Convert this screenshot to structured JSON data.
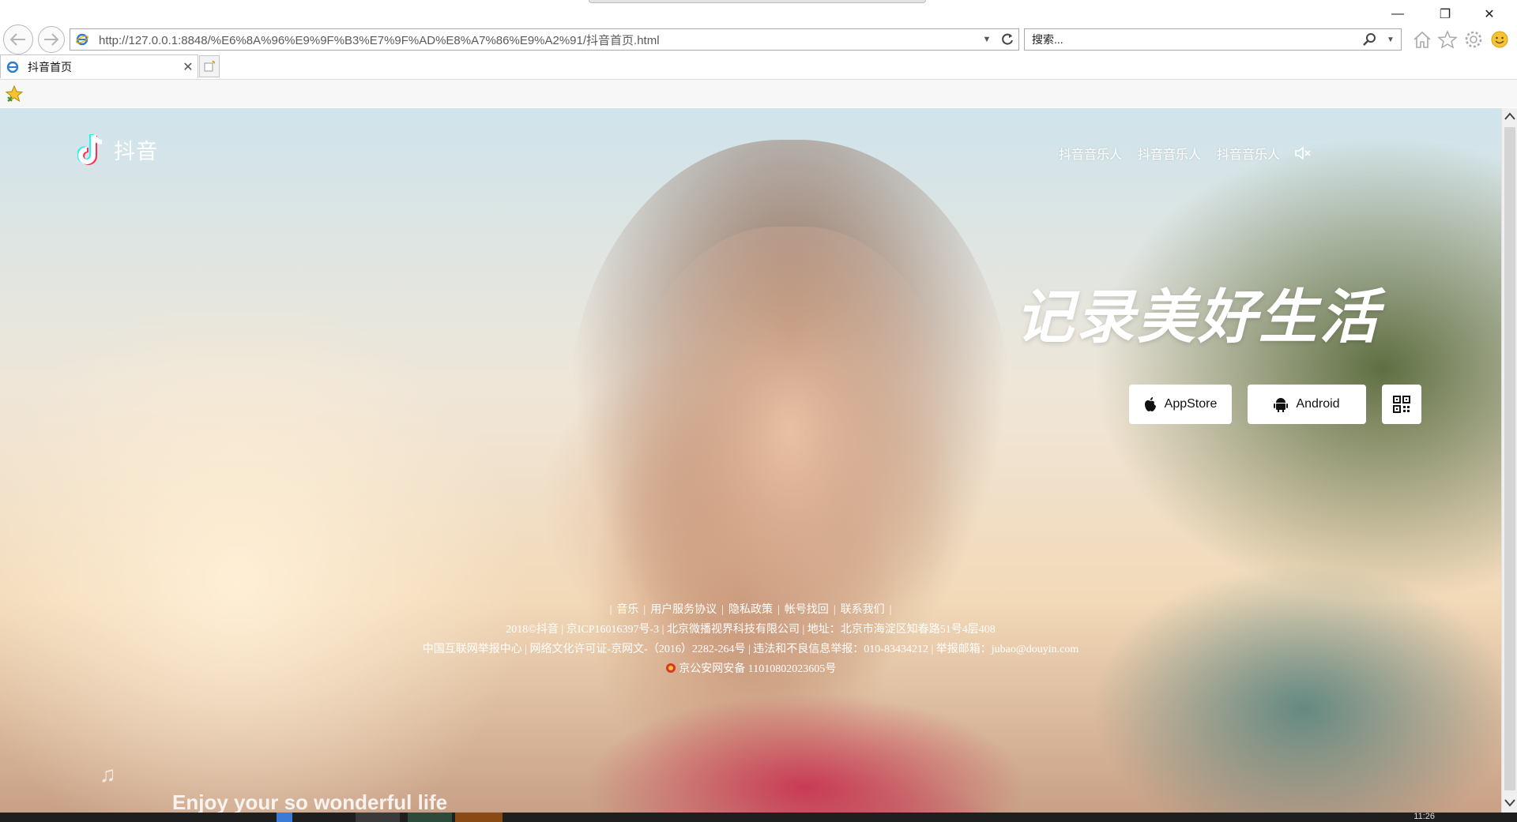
{
  "browser": {
    "address_url": "http://127.0.0.1:8848/%E6%8A%96%E9%9F%B3%E7%9F%AD%E8%A7%86%E9%A2%91/抖音首页.html",
    "search_placeholder": "搜索...",
    "tab_title": "抖音首页",
    "window_controls": {
      "minimize": "—",
      "restore": "❐",
      "close": "✕"
    },
    "clock": "11:26"
  },
  "page": {
    "logo_text": "抖音",
    "nav_links": [
      "抖音音乐人",
      "抖音音乐人",
      "抖音音乐人"
    ],
    "slogan": "记录美好生活",
    "download": {
      "appstore": "AppStore",
      "android": "Android"
    },
    "footer": {
      "line1_links": [
        "音乐",
        "用户服务协议",
        "隐私政策",
        "帐号找回",
        "联系我们"
      ],
      "line2": "2018©抖音 | 京ICP16016397号-3 | 北京微播视界科技有限公司 | 地址：北京市海淀区知春路51号4层408",
      "line3": "中国互联网举报中心 | 网络文化许可证-京网文-（2016）2282-264号 | 违法和不良信息举报：010-83434212 | 举报邮箱：jubao@douyin.com",
      "line4": "京公安网安备 11010802023605号"
    },
    "bottom_text": "Enjoy your so wonderful life"
  }
}
